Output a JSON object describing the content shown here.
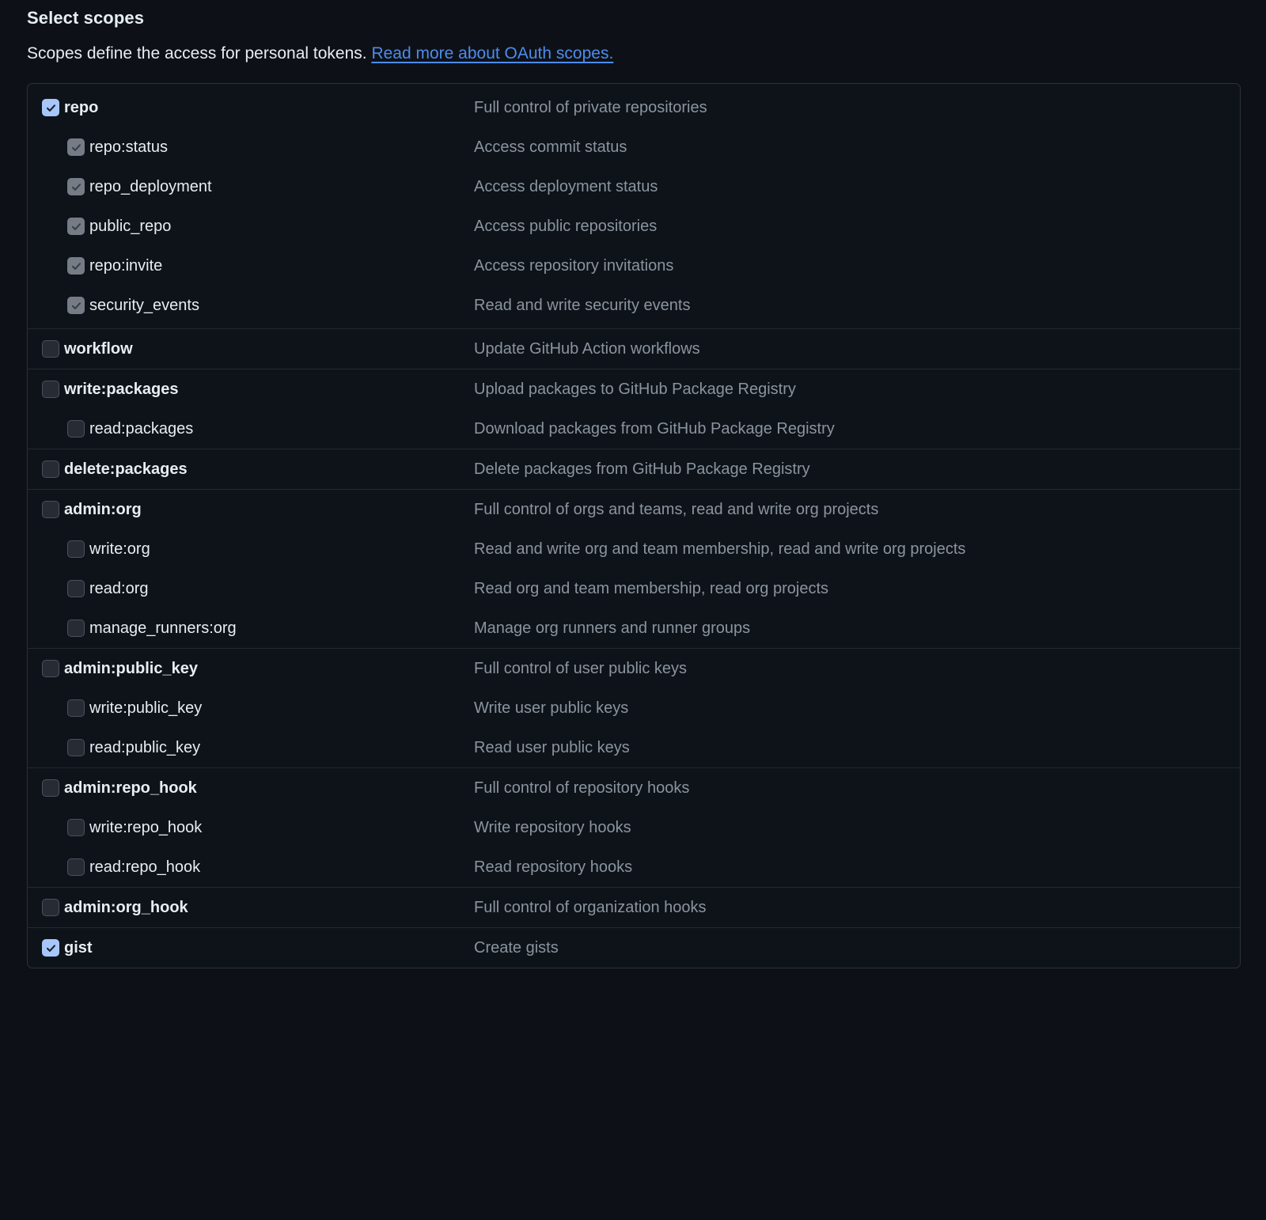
{
  "header": {
    "title": "Select scopes",
    "description_prefix": "Scopes define the access for personal tokens.",
    "link_text": "Read more about OAuth scopes."
  },
  "colors": {
    "page_background": "#0d1117",
    "panel_background": "#0e1319",
    "panel_border": "#2c3138",
    "row_divider": "#242930",
    "text_primary": "#e6edf3",
    "text_muted": "#8b949e",
    "link": "#4e8beb",
    "checkbox_checked": "#a7c7fa",
    "checkbox_locked": "#767c85",
    "checkbox_unchecked": "#272b33",
    "checkbox_unchecked_border": "#4a515b"
  },
  "scope_groups": [
    {
      "id": "repo",
      "rows": [
        {
          "name": "repo",
          "desc": "Full control of private repositories",
          "level": "parent",
          "state": "checked"
        },
        {
          "name": "repo:status",
          "desc": "Access commit status",
          "level": "child",
          "state": "locked"
        },
        {
          "name": "repo_deployment",
          "desc": "Access deployment status",
          "level": "child",
          "state": "locked"
        },
        {
          "name": "public_repo",
          "desc": "Access public repositories",
          "level": "child",
          "state": "locked"
        },
        {
          "name": "repo:invite",
          "desc": "Access repository invitations",
          "level": "child",
          "state": "locked"
        },
        {
          "name": "security_events",
          "desc": "Read and write security events",
          "level": "child",
          "state": "locked"
        }
      ]
    },
    {
      "id": "workflow",
      "rows": [
        {
          "name": "workflow",
          "desc": "Update GitHub Action workflows",
          "level": "parent",
          "state": "unchecked"
        }
      ]
    },
    {
      "id": "packages",
      "rows": [
        {
          "name": "write:packages",
          "desc": "Upload packages to GitHub Package Registry",
          "level": "parent",
          "state": "unchecked"
        },
        {
          "name": "read:packages",
          "desc": "Download packages from GitHub Package Registry",
          "level": "child",
          "state": "unchecked"
        }
      ]
    },
    {
      "id": "delete-packages",
      "rows": [
        {
          "name": "delete:packages",
          "desc": "Delete packages from GitHub Package Registry",
          "level": "parent",
          "state": "unchecked"
        }
      ]
    },
    {
      "id": "admin-org",
      "rows": [
        {
          "name": "admin:org",
          "desc": "Full control of orgs and teams, read and write org projects",
          "level": "parent",
          "state": "unchecked"
        },
        {
          "name": "write:org",
          "desc": "Read and write org and team membership, read and write org projects",
          "level": "child",
          "state": "unchecked"
        },
        {
          "name": "read:org",
          "desc": "Read org and team membership, read org projects",
          "level": "child",
          "state": "unchecked"
        },
        {
          "name": "manage_runners:org",
          "desc": "Manage org runners and runner groups",
          "level": "child",
          "state": "unchecked"
        }
      ]
    },
    {
      "id": "admin-public-key",
      "rows": [
        {
          "name": "admin:public_key",
          "desc": "Full control of user public keys",
          "level": "parent",
          "state": "unchecked"
        },
        {
          "name": "write:public_key",
          "desc": "Write user public keys",
          "level": "child",
          "state": "unchecked"
        },
        {
          "name": "read:public_key",
          "desc": "Read user public keys",
          "level": "child",
          "state": "unchecked"
        }
      ]
    },
    {
      "id": "admin-repo-hook",
      "rows": [
        {
          "name": "admin:repo_hook",
          "desc": "Full control of repository hooks",
          "level": "parent",
          "state": "unchecked"
        },
        {
          "name": "write:repo_hook",
          "desc": "Write repository hooks",
          "level": "child",
          "state": "unchecked"
        },
        {
          "name": "read:repo_hook",
          "desc": "Read repository hooks",
          "level": "child",
          "state": "unchecked"
        }
      ]
    },
    {
      "id": "admin-org-hook",
      "rows": [
        {
          "name": "admin:org_hook",
          "desc": "Full control of organization hooks",
          "level": "parent",
          "state": "unchecked"
        }
      ]
    },
    {
      "id": "gist",
      "rows": [
        {
          "name": "gist",
          "desc": "Create gists",
          "level": "parent",
          "state": "checked"
        }
      ]
    }
  ]
}
